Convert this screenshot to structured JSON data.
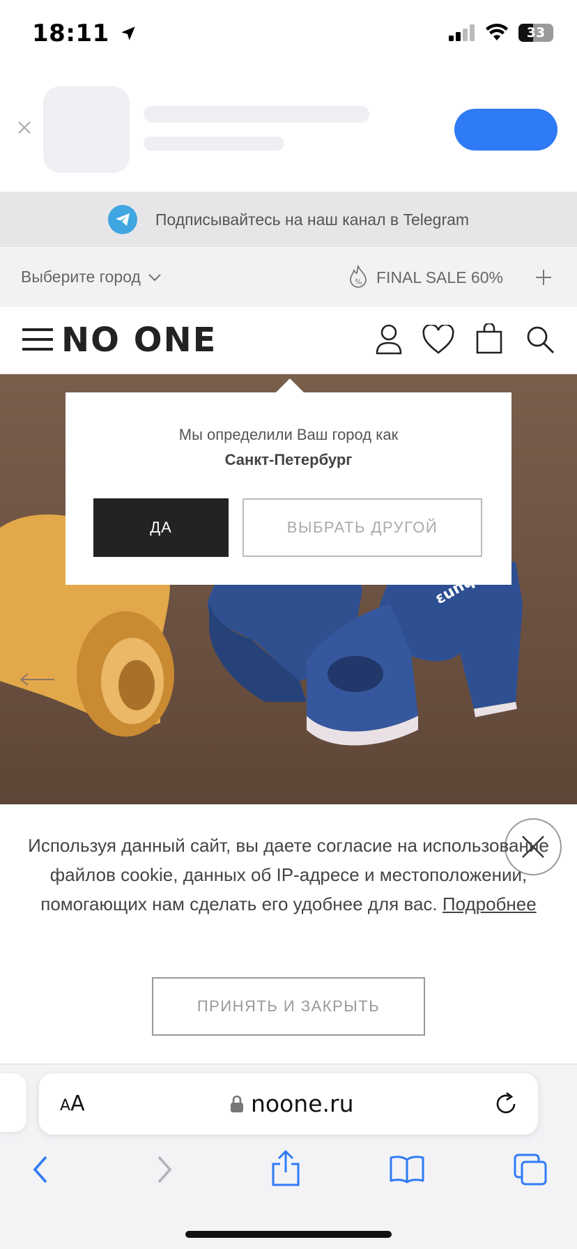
{
  "status": {
    "time": "18:11",
    "battery": "33"
  },
  "telegram": {
    "text": "Подписывайтесь на наш канал в Telegram"
  },
  "citybar": {
    "select_label": "Выберите город",
    "sale_label": "FINAL SALE 60%"
  },
  "header": {
    "logo": "NO ONE"
  },
  "popup": {
    "question": "Мы определили Ваш город как",
    "city": "Санкт-Петербург",
    "yes_label": "ДА",
    "other_label": "ВЫБРАТЬ ДРУГОЙ"
  },
  "cookie": {
    "text": "Используя данный сайт, вы даете согласие на использование файлов cookie, данных об IP-адресе и местоположении, помогающих нам сделать его удобнее для вас.",
    "more_link": "Подробнее",
    "accept_label": "ПРИНЯТЬ И ЗАКРЫТЬ"
  },
  "safari": {
    "aa_small": "A",
    "aa_big": "A",
    "url": "noone.ru"
  },
  "colors": {
    "accent_blue": "#2f7bf5",
    "telegram": "#3fa6e2",
    "dark_button": "#232323"
  }
}
